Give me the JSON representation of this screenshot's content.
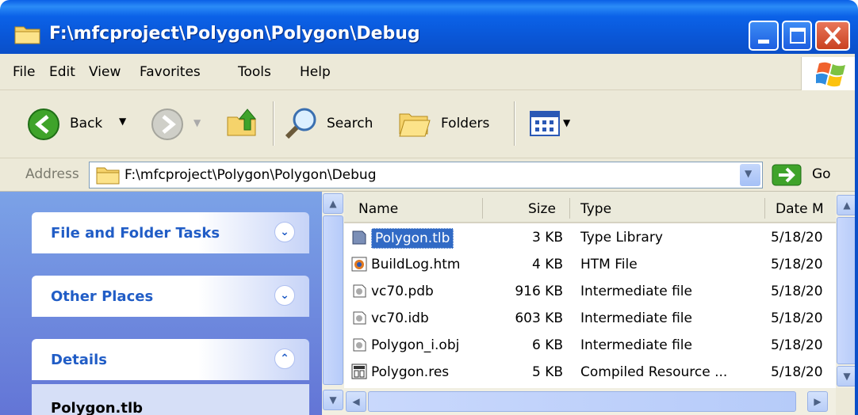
{
  "window": {
    "title": "F:\\mfcproject\\Polygon\\Polygon\\Debug"
  },
  "menu": {
    "items": [
      "File",
      "Edit",
      "View",
      "Favorites",
      "Tools",
      "Help"
    ]
  },
  "toolbar": {
    "back_label": "Back",
    "search_label": "Search",
    "folders_label": "Folders"
  },
  "address": {
    "label": "Address",
    "value": "F:\\mfcproject\\Polygon\\Polygon\\Debug",
    "go_label": "Go"
  },
  "tasks": {
    "file_folder": "File and Folder Tasks",
    "other_places": "Other Places",
    "details": "Details",
    "details_item": "Polygon.tlb"
  },
  "columns": {
    "name": "Name",
    "size": "Size",
    "type": "Type",
    "date": "Date M"
  },
  "files": [
    {
      "name": "Polygon.tlb",
      "size": "3 KB",
      "type": "Type Library",
      "date": "5/18/20",
      "icon": "type-library-icon"
    },
    {
      "name": "BuildLog.htm",
      "size": "4 KB",
      "type": "HTM File",
      "date": "5/18/20",
      "icon": "html-file-icon"
    },
    {
      "name": "vc70.pdb",
      "size": "916 KB",
      "type": "Intermediate file",
      "date": "5/18/20",
      "icon": "generic-file-icon"
    },
    {
      "name": "vc70.idb",
      "size": "603 KB",
      "type": "Intermediate file",
      "date": "5/18/20",
      "icon": "generic-file-icon"
    },
    {
      "name": "Polygon_i.obj",
      "size": "6 KB",
      "type": "Intermediate file",
      "date": "5/18/20",
      "icon": "generic-file-icon"
    },
    {
      "name": "Polygon.res",
      "size": "5 KB",
      "type": "Compiled Resource ...",
      "date": "5/18/20",
      "icon": "resource-file-icon"
    }
  ],
  "colors": {
    "title_blue": "#0a56d6",
    "task_pane": "#6f8de0",
    "selection": "#316ac5",
    "chrome": "#ece9d8"
  }
}
